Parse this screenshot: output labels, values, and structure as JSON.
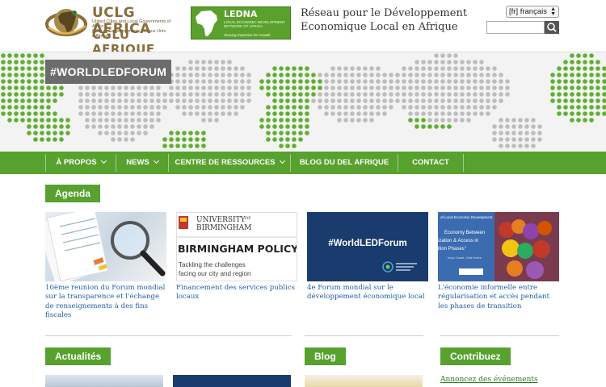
{
  "header": {
    "uclg_title": "UCLG AFRICA",
    "uclg_sub1": "United Cities and Local Governments of Africa",
    "uclg_sub2": "Cités et Gouvernements Locaux Unis d'Afrique",
    "uclg_cglu": "CGLU AFRIQUE",
    "ledna_title": "LEDNA",
    "ledna_sub1": "LOCAL ECONOMIC DEVELOPMENT",
    "ledna_sub2": "NETWORK OF AFRICA",
    "ledna_tagline": "Sharing Expertise for Growth",
    "site_title_line1": "Réseau pour le Développement",
    "site_title_line2": "Economique Local en Afrique",
    "language": "[fr] français",
    "search_placeholder": ""
  },
  "banner": {
    "hashtag": "#WORLDLEDFORUM"
  },
  "nav": {
    "items": [
      {
        "label": "À PROPOS"
      },
      {
        "label": "NEWS"
      },
      {
        "label": "CENTRE DE RESSOURCES"
      },
      {
        "label": "BLOG DU DEL AFRIQUE"
      },
      {
        "label": "CONTACT"
      }
    ]
  },
  "agenda": {
    "title": "Agenda",
    "cards": [
      {
        "caption": "10ème reunion du Forum mondial sur la transparence et l'échange de renseignements à des fins fiscales"
      },
      {
        "caption": "Financement des services publics locaux",
        "img_line1": "UNIVERSITY",
        "img_of": "OF",
        "img_line2": "BIRMINGHAM",
        "img_big": "BIRMINGHAM POLICY LAB",
        "img_small1": "Tackling the challenges",
        "img_small2": "facing our city and region"
      },
      {
        "caption": "4e Forum mondial sur le développement économique local",
        "img_text": "#WorldLEDForum"
      },
      {
        "caption": "L'économie informelle entre régularisation et accès pendant les phases de transition",
        "img_t1": "of Local Economic Development",
        "img_t2": "Economy Between",
        "img_t3": "ization & Access in",
        "img_t4": "ition Phases\"",
        "img_t5": "Ivory Coast, Côte Ivoire"
      }
    ]
  },
  "sections": {
    "actualites": "Actualités",
    "blog": "Blog",
    "contribuez": "Contribuez",
    "contribuez_link": "Annoncez des événements"
  },
  "colors": {
    "brand_green": "#57a12f",
    "link_blue": "#1f5fa5",
    "banner_gray": "#6c6c6c"
  }
}
